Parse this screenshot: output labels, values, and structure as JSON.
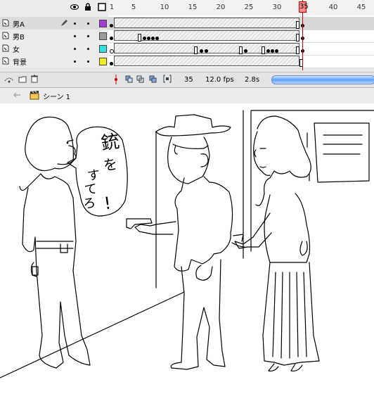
{
  "layers": [
    {
      "name": "男A",
      "color": "#a23cd8",
      "selected": true
    },
    {
      "name": "男B",
      "color": "#9a9a9a"
    },
    {
      "name": "女",
      "color": "#33e0e0"
    },
    {
      "name": "背景",
      "color": "#f0f020"
    }
  ],
  "ruler": {
    "marks": [
      "1",
      "5",
      "10",
      "15",
      "20",
      "25",
      "30",
      "35",
      "40",
      "45"
    ]
  },
  "playhead": {
    "frame": "35"
  },
  "status": {
    "current_frame": "35",
    "fps": "12.0 fps",
    "elapsed": "2.8s"
  },
  "scene": {
    "label": "シーン 1"
  },
  "speech": {
    "chars": [
      "銃",
      "を",
      "す",
      "て",
      "ろ",
      "!"
    ]
  },
  "icons": {
    "eye": "eye-icon",
    "lock": "lock-icon",
    "outline": "outline-icon",
    "pencil": "pencil-icon",
    "add_layer": "add-layer-icon",
    "add_folder": "add-folder-icon",
    "delete": "trash-icon",
    "back": "back-arrow-icon",
    "scene": "clapperboard-icon"
  }
}
